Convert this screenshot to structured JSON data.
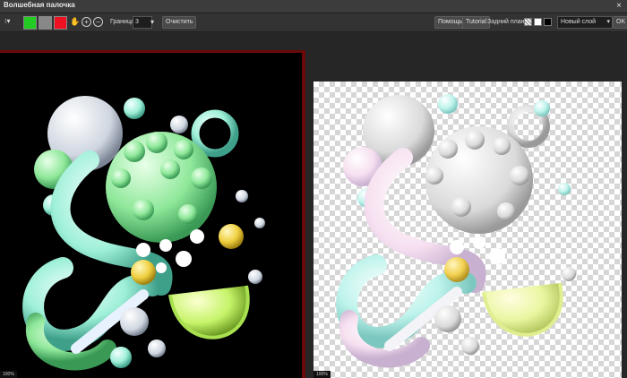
{
  "window": {
    "title": "Волшебная палочка",
    "close_symbol": "×"
  },
  "toolbar": {
    "tool_glyph": "⁝▾",
    "swatch_1": "#22cc22",
    "swatch_2": "#888888",
    "swatch_3": "#ee1122",
    "hand_glyph": "✋",
    "add_glyph": "+",
    "subtract_glyph": "−",
    "border_label": "Граница",
    "border_value": "3",
    "border_dropdown": "▾",
    "clear_label": "Очистить",
    "help_label": "Помощь",
    "tutorial_label": "Tutorial",
    "background_label": "Задний план",
    "new_layer_select": "Новый слой",
    "new_layer_arrow": "▾",
    "ok_label": "OK"
  },
  "canvases": {
    "left_zoom": "100%",
    "right_zoom": "100%"
  }
}
